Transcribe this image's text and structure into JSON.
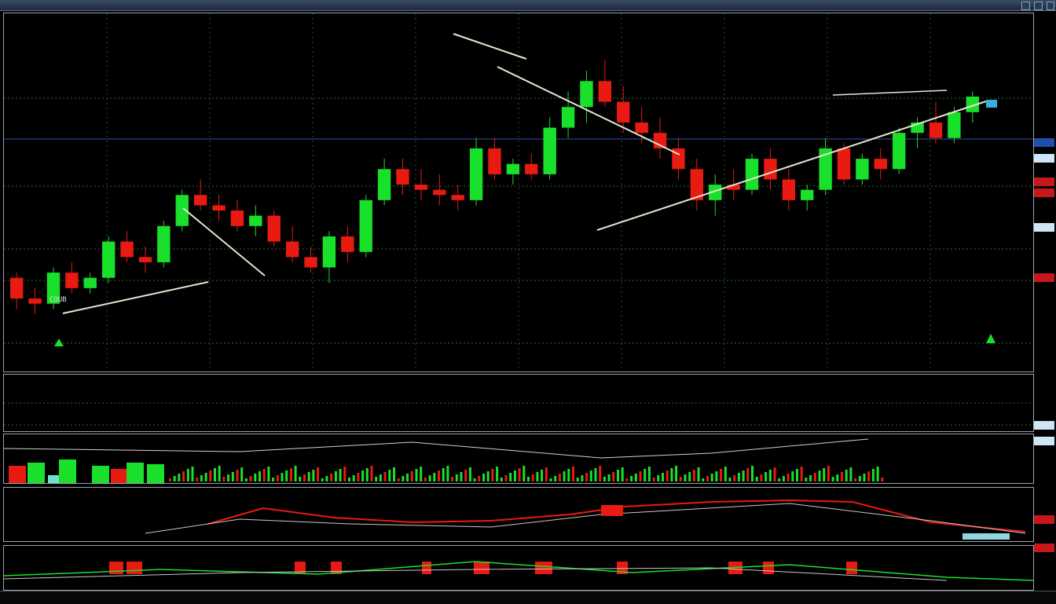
{
  "window": {
    "title_left": "",
    "title_mid": "",
    "title_right": ""
  },
  "main_chart": {
    "legend_text": "",
    "annotation_left": "COUB",
    "annotation_right": "",
    "bull_color": "#19e02a",
    "bear_color": "#e81a12",
    "trendline_color": "#e6e6d2",
    "candles": [
      {
        "o": 58,
        "h": 60,
        "l": 46,
        "c": 50
      },
      {
        "o": 50,
        "h": 54,
        "l": 44,
        "c": 48
      },
      {
        "o": 48,
        "h": 62,
        "l": 46,
        "c": 60
      },
      {
        "o": 60,
        "h": 64,
        "l": 52,
        "c": 54
      },
      {
        "o": 54,
        "h": 60,
        "l": 52,
        "c": 58
      },
      {
        "o": 58,
        "h": 74,
        "l": 56,
        "c": 72
      },
      {
        "o": 72,
        "h": 76,
        "l": 64,
        "c": 66
      },
      {
        "o": 66,
        "h": 70,
        "l": 60,
        "c": 64
      },
      {
        "o": 64,
        "h": 80,
        "l": 62,
        "c": 78
      },
      {
        "o": 78,
        "h": 92,
        "l": 76,
        "c": 90
      },
      {
        "o": 90,
        "h": 96,
        "l": 84,
        "c": 86
      },
      {
        "o": 86,
        "h": 90,
        "l": 80,
        "c": 84
      },
      {
        "o": 84,
        "h": 88,
        "l": 76,
        "c": 78
      },
      {
        "o": 78,
        "h": 86,
        "l": 74,
        "c": 82
      },
      {
        "o": 82,
        "h": 84,
        "l": 70,
        "c": 72
      },
      {
        "o": 72,
        "h": 78,
        "l": 64,
        "c": 66
      },
      {
        "o": 66,
        "h": 70,
        "l": 60,
        "c": 62
      },
      {
        "o": 62,
        "h": 76,
        "l": 56,
        "c": 74
      },
      {
        "o": 74,
        "h": 78,
        "l": 64,
        "c": 68
      },
      {
        "o": 68,
        "h": 90,
        "l": 66,
        "c": 88
      },
      {
        "o": 88,
        "h": 104,
        "l": 86,
        "c": 100
      },
      {
        "o": 100,
        "h": 104,
        "l": 90,
        "c": 94
      },
      {
        "o": 94,
        "h": 100,
        "l": 88,
        "c": 92
      },
      {
        "o": 92,
        "h": 98,
        "l": 86,
        "c": 90
      },
      {
        "o": 90,
        "h": 94,
        "l": 84,
        "c": 88
      },
      {
        "o": 88,
        "h": 112,
        "l": 86,
        "c": 108
      },
      {
        "o": 108,
        "h": 112,
        "l": 96,
        "c": 98
      },
      {
        "o": 98,
        "h": 104,
        "l": 94,
        "c": 102
      },
      {
        "o": 102,
        "h": 106,
        "l": 96,
        "c": 98
      },
      {
        "o": 98,
        "h": 120,
        "l": 96,
        "c": 116
      },
      {
        "o": 116,
        "h": 130,
        "l": 112,
        "c": 124
      },
      {
        "o": 124,
        "h": 138,
        "l": 118,
        "c": 134
      },
      {
        "o": 134,
        "h": 142,
        "l": 124,
        "c": 126
      },
      {
        "o": 126,
        "h": 132,
        "l": 114,
        "c": 118
      },
      {
        "o": 118,
        "h": 124,
        "l": 110,
        "c": 114
      },
      {
        "o": 114,
        "h": 120,
        "l": 104,
        "c": 108
      },
      {
        "o": 108,
        "h": 112,
        "l": 96,
        "c": 100
      },
      {
        "o": 100,
        "h": 104,
        "l": 84,
        "c": 88
      },
      {
        "o": 88,
        "h": 98,
        "l": 82,
        "c": 94
      },
      {
        "o": 94,
        "h": 100,
        "l": 88,
        "c": 92
      },
      {
        "o": 92,
        "h": 106,
        "l": 90,
        "c": 104
      },
      {
        "o": 104,
        "h": 108,
        "l": 92,
        "c": 96
      },
      {
        "o": 96,
        "h": 100,
        "l": 84,
        "c": 88
      },
      {
        "o": 88,
        "h": 94,
        "l": 84,
        "c": 92
      },
      {
        "o": 92,
        "h": 112,
        "l": 90,
        "c": 108
      },
      {
        "o": 108,
        "h": 110,
        "l": 94,
        "c": 96
      },
      {
        "o": 96,
        "h": 106,
        "l": 94,
        "c": 104
      },
      {
        "o": 104,
        "h": 108,
        "l": 96,
        "c": 100
      },
      {
        "o": 100,
        "h": 116,
        "l": 98,
        "c": 114
      },
      {
        "o": 114,
        "h": 120,
        "l": 108,
        "c": 118
      },
      {
        "o": 118,
        "h": 126,
        "l": 110,
        "c": 112
      },
      {
        "o": 112,
        "h": 124,
        "l": 110,
        "c": 122
      },
      {
        "o": 122,
        "h": 130,
        "l": 118,
        "c": 128
      }
    ]
  },
  "right_axis_tags": [
    {
      "text": "",
      "bg": "#1e4fb0"
    },
    {
      "text": "",
      "bg": "#cfe6f5"
    },
    {
      "text": "",
      "bg": "#c8171b"
    },
    {
      "text": "",
      "bg": "#c8171b"
    },
    {
      "text": "",
      "bg": "#cfe6f5"
    },
    {
      "text": "",
      "bg": "#c8171b"
    },
    {
      "text": "",
      "bg": "#cfe6f5"
    },
    {
      "text": "",
      "bg": "#cfe6f5"
    },
    {
      "text": "",
      "bg": "#c8171b"
    },
    {
      "text": "",
      "bg": "#c8171b"
    }
  ],
  "panels": {
    "panel1_title": "",
    "panel2_title": "",
    "panel2_label": "",
    "panel3_title": "",
    "panel3_sub": "",
    "panel4_title": ""
  },
  "time_axis": {
    "labels": [
      "",
      "",
      "",
      "",
      "",
      "",
      "",
      "",
      "",
      "",
      "",
      "",
      "",
      "",
      "",
      "",
      "",
      "",
      "",
      "",
      "",
      "",
      "",
      "",
      ""
    ]
  }
}
